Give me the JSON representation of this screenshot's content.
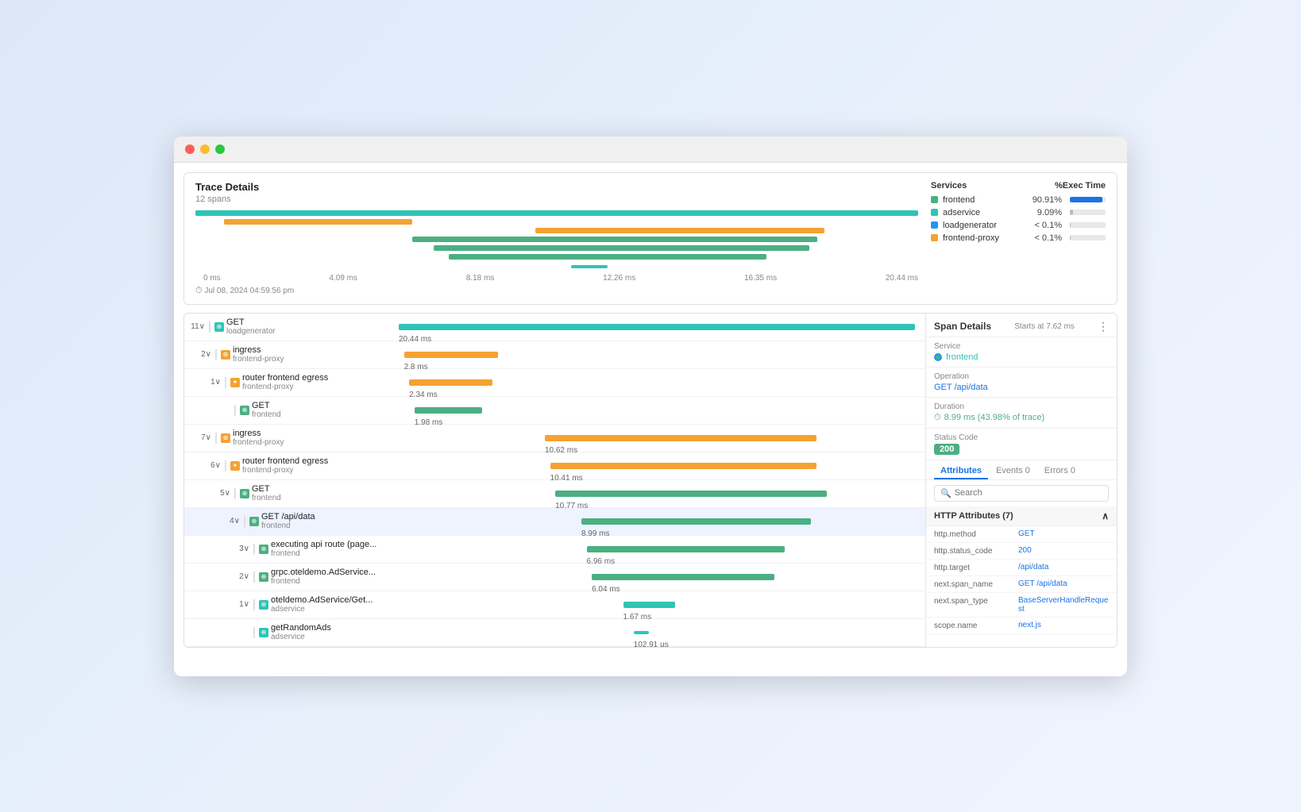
{
  "window": {
    "dots": [
      "red",
      "yellow",
      "green"
    ]
  },
  "trace_overview": {
    "title": "Trace Details",
    "subtitle": "12 spans",
    "date": "Jul 08, 2024 04:59:56 pm",
    "time_axis": [
      "0 ms",
      "4.09 ms",
      "8.18 ms",
      "12.26 ms",
      "16.35 ms",
      "20.44 ms"
    ],
    "bars": [
      {
        "color": "teal",
        "left": "0%",
        "width": "100%"
      },
      {
        "color": "orange",
        "left": "5%",
        "width": "35%"
      },
      {
        "color": "orange",
        "left": "45%",
        "width": "40%"
      },
      {
        "color": "green",
        "left": "30%",
        "width": "55%"
      },
      {
        "color": "green",
        "left": "25%",
        "width": "50%"
      },
      {
        "color": "green",
        "left": "38%",
        "width": "30%"
      },
      {
        "color": "teal",
        "left": "55%",
        "width": "8%"
      }
    ],
    "services": {
      "header": "Services",
      "pct_header": "%Exec Time",
      "items": [
        {
          "name": "frontend",
          "color": "#4caf82",
          "pct": "90.91%",
          "bar_pct": 91,
          "bar_color": "#1a73e8"
        },
        {
          "name": "adservice",
          "color": "#2ec4b6",
          "pct": "9.09%",
          "bar_pct": 9,
          "bar_color": "#bbb"
        },
        {
          "name": "loadgenerator",
          "color": "#2196f3",
          "pct": "< 0.1%",
          "bar_pct": 1,
          "bar_color": "#bbb"
        },
        {
          "name": "frontend-proxy",
          "color": "#f4a232",
          "pct": "< 0.1%",
          "bar_pct": 1,
          "bar_color": "#bbb"
        }
      ]
    }
  },
  "spans": [
    {
      "id": "span-get-loadgen",
      "count": "11",
      "chevron": "∨",
      "icon_type": "teal",
      "icon": "⊕",
      "name": "GET",
      "service": "loadgenerator",
      "duration": "20.44 ms",
      "bar_color": "#2ec4b6",
      "bar_left": "0%",
      "bar_width": "100%",
      "indent": 0
    },
    {
      "id": "span-ingress-1",
      "count": "2",
      "chevron": "∨",
      "icon_type": "orange",
      "icon": "⊕",
      "name": "ingress",
      "service": "frontend-proxy",
      "duration": "2.8 ms",
      "bar_color": "#f4a232",
      "bar_left": "1%",
      "bar_width": "18%",
      "indent": 1
    },
    {
      "id": "span-router-egress-1",
      "count": "1",
      "chevron": "∨",
      "icon_type": "orange",
      "icon": "✦",
      "name": "router frontend egress",
      "service": "frontend-proxy",
      "duration": "2.34 ms",
      "bar_color": "#f4a232",
      "bar_left": "2%",
      "bar_width": "16%",
      "indent": 2
    },
    {
      "id": "span-get-frontend-1",
      "count": "",
      "chevron": "",
      "icon_type": "green",
      "icon": "⊕",
      "name": "GET",
      "service": "frontend",
      "duration": "1.98 ms",
      "bar_color": "#4caf82",
      "bar_left": "3%",
      "bar_width": "14%",
      "indent": 3
    },
    {
      "id": "span-ingress-2",
      "count": "7",
      "chevron": "∨",
      "icon_type": "orange",
      "icon": "⊕",
      "name": "ingress",
      "service": "frontend-proxy",
      "duration": "10.62 ms",
      "bar_color": "#f4a232",
      "bar_left": "28%",
      "bar_width": "52%",
      "indent": 1
    },
    {
      "id": "span-router-egress-2",
      "count": "6",
      "chevron": "∨",
      "icon_type": "orange",
      "icon": "✦",
      "name": "router frontend egress",
      "service": "frontend-proxy",
      "duration": "10.41 ms",
      "bar_color": "#f4a232",
      "bar_left": "29%",
      "bar_width": "51%",
      "indent": 2
    },
    {
      "id": "span-get-frontend-2",
      "count": "5",
      "chevron": "∨",
      "icon_type": "green",
      "icon": "⊕",
      "name": "GET",
      "service": "frontend",
      "duration": "10.77 ms",
      "bar_color": "#4caf82",
      "bar_left": "30%",
      "bar_width": "52%",
      "indent": 3
    },
    {
      "id": "span-get-api-data",
      "count": "4",
      "chevron": "∨",
      "icon_type": "green",
      "icon": "⊕",
      "name": "GET /api/data",
      "service": "frontend",
      "duration": "8.99 ms",
      "bar_color": "#4caf82",
      "bar_left": "32%",
      "bar_width": "44%",
      "indent": 4,
      "selected": true
    },
    {
      "id": "span-executing-api",
      "count": "3",
      "chevron": "∨",
      "icon_type": "green",
      "icon": "⊕",
      "name": "executing api route (page...",
      "service": "frontend",
      "duration": "6.96 ms",
      "bar_color": "#4caf82",
      "bar_left": "33%",
      "bar_width": "38%",
      "indent": 5
    },
    {
      "id": "span-grpc",
      "count": "2",
      "chevron": "∨",
      "icon_type": "green",
      "icon": "⊕",
      "name": "grpc.oteldemo.AdService...",
      "service": "frontend",
      "duration": "6.04 ms",
      "bar_color": "#4caf82",
      "bar_left": "34%",
      "bar_width": "35%",
      "indent": 5
    },
    {
      "id": "span-oteldemo",
      "count": "1",
      "chevron": "∨",
      "icon_type": "teal",
      "icon": "⊕",
      "name": "oteldemo.AdService/Get...",
      "service": "adservice",
      "duration": "1.67 ms",
      "bar_color": "#2ec4b6",
      "bar_left": "42%",
      "bar_width": "10%",
      "indent": 5
    },
    {
      "id": "span-getrandomads",
      "count": "",
      "chevron": "",
      "icon_type": "teal",
      "icon": "⊕",
      "name": "getRandomAds",
      "service": "adservice",
      "duration": "102.91 µs",
      "bar_color": "#2ec4b6",
      "bar_left": "44%",
      "bar_width": "3%",
      "indent": 5
    }
  ],
  "span_details": {
    "title": "Span Details",
    "starts_at": "Starts at 7.62 ms",
    "service_label": "Service",
    "service_value": "frontend",
    "operation_label": "Operation",
    "operation_value": "GET /api/data",
    "duration_label": "Duration",
    "duration_value": "8.99 ms (43.98% of trace)",
    "status_code_label": "Status Code",
    "status_code_value": "200",
    "tabs": [
      {
        "label": "Attributes",
        "active": true
      },
      {
        "label": "Events",
        "count": "0"
      },
      {
        "label": "Errors",
        "count": "0"
      }
    ],
    "search_placeholder": "Search",
    "http_attrs_header": "HTTP Attributes (7)",
    "attributes": [
      {
        "key": "http.method",
        "value": "GET"
      },
      {
        "key": "http.status_code",
        "value": "200"
      },
      {
        "key": "http.target",
        "value": "/api/data"
      },
      {
        "key": "next.span_name",
        "value": "GET /api/data"
      },
      {
        "key": "next.span_type",
        "value": "BaseServerHandleRequest"
      },
      {
        "key": "scope.name",
        "value": "next.js"
      }
    ]
  }
}
